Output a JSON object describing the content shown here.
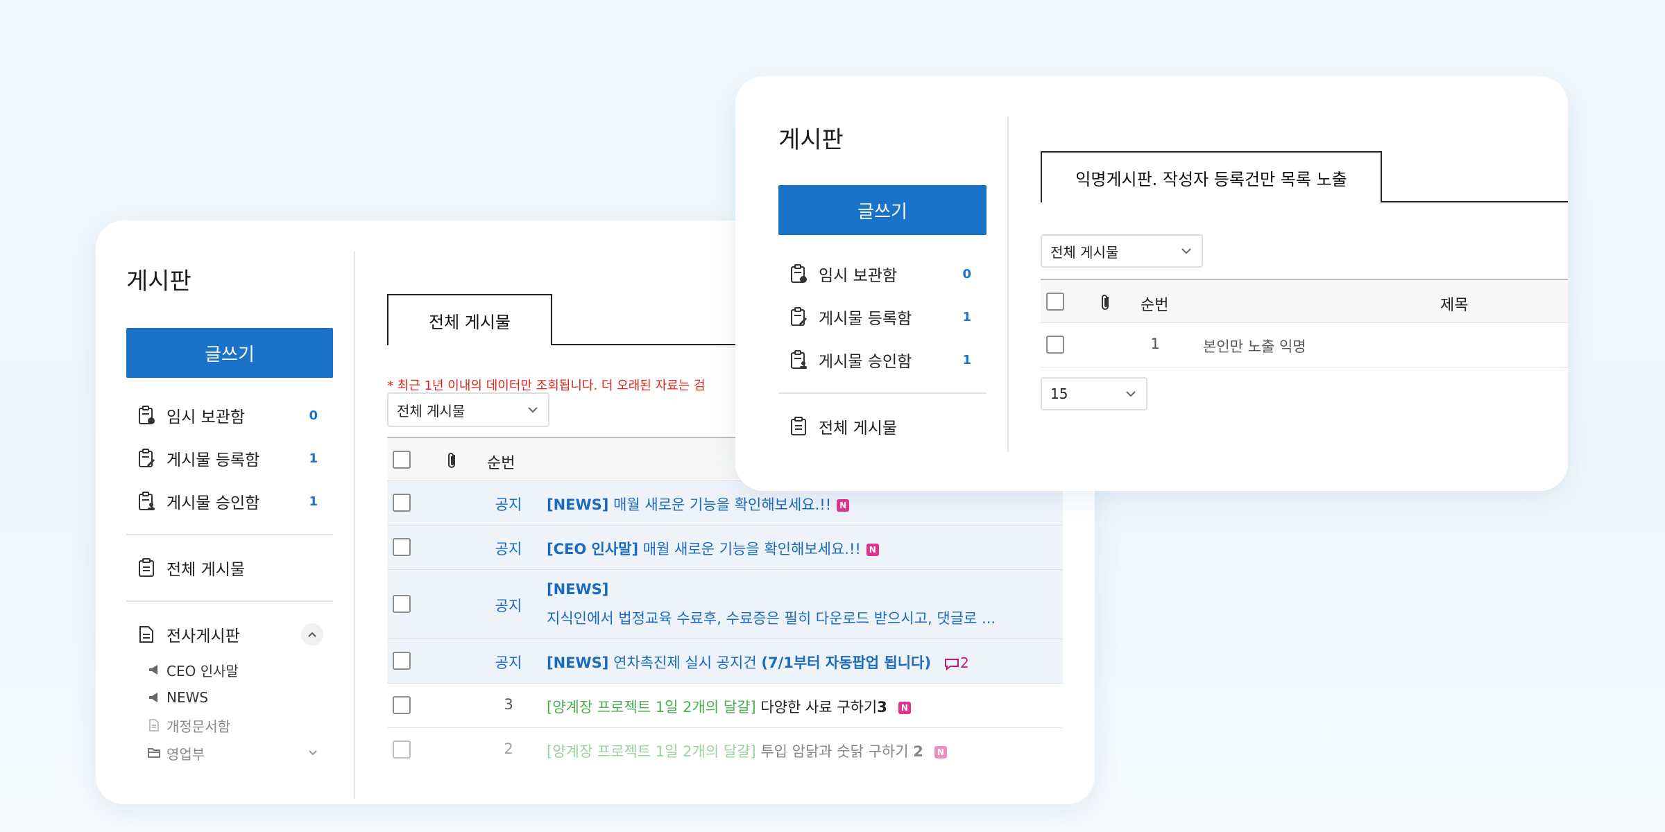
{
  "back": {
    "sidebar": {
      "title": "게시판",
      "write_label": "글쓰기",
      "menu": [
        {
          "label": "임시 보관함",
          "count": "0"
        },
        {
          "label": "게시물 등록함",
          "count": "1"
        },
        {
          "label": "게시물 승인함",
          "count": "1"
        }
      ],
      "all_posts": "전체 게시물",
      "group": {
        "label": "전사게시판",
        "items": [
          {
            "label": "CEO 인사말"
          },
          {
            "label": "NEWS"
          },
          {
            "label": "개정문서함"
          },
          {
            "label": "영업부"
          }
        ]
      }
    },
    "main": {
      "tab": "전체 게시물",
      "notice": "* 최근 1년 이내의 데이터만 조회됩니다. 더 오래된 자료는 검",
      "filter": "전체 게시물",
      "table": {
        "col_no": "순번",
        "rows": [
          {
            "no": "공지",
            "prefix": "[NEWS]",
            "title": "매월 새로운 기능을 확인해보세요.!!",
            "badge": "N"
          },
          {
            "no": "공지",
            "prefix": "[CEO 인사말]",
            "title": "매월 새로운 기능을 확인해보세요.!!",
            "badge": "N"
          },
          {
            "no": "공지",
            "prefix": "[NEWS]",
            "title": "지식인에서 법정교육 수료후, 수료증은 필히 다운로드 받으시고, 댓글로 ..."
          },
          {
            "no": "공지",
            "prefix": "[NEWS]",
            "title": "연차촉진제 실시 공지건",
            "title_bold": "(7/1부터 자동팝업 됩니다)",
            "comments": "2"
          },
          {
            "no": "3",
            "prefix": "[양계장 프로젝트 1일 2개의 달걀]",
            "title": "다양한 사료 구하기",
            "title_suffix": "3",
            "badge": "N"
          },
          {
            "no": "2",
            "prefix": "[양계장 프로젝트 1일 2개의 달걀]",
            "title": "투입 암닭과 숫닭 구하기",
            "title_suffix": "2",
            "badge": "N"
          }
        ]
      }
    }
  },
  "front": {
    "sidebar": {
      "title": "게시판",
      "write_label": "글쓰기",
      "menu": [
        {
          "label": "임시 보관함",
          "count": "0"
        },
        {
          "label": "게시물 등록함",
          "count": "1"
        },
        {
          "label": "게시물 승인함",
          "count": "1"
        }
      ],
      "all_posts": "전체 게시물"
    },
    "main": {
      "tab": "익명게시판. 작성자 등록건만 목록 노출",
      "filter": "전체 게시물",
      "table": {
        "col_no": "순번",
        "col_title": "제목",
        "rows": [
          {
            "no": "1",
            "title": "본인만 노출 익명"
          }
        ]
      },
      "page_size": "15"
    }
  }
}
